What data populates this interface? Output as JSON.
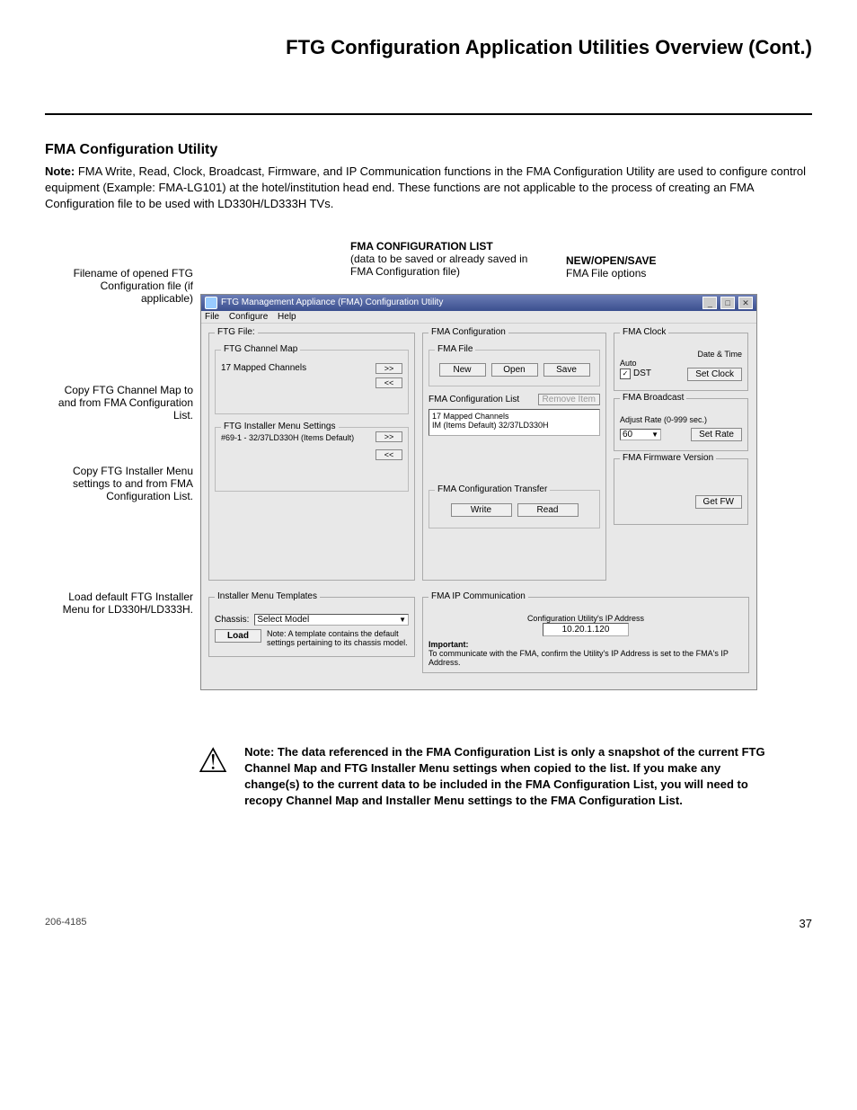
{
  "page": {
    "title": "FTG Configuration Application Utilities Overview (Cont.)",
    "section_title": "FMA Configuration Utility",
    "note_label": "Note:",
    "note_body": " FMA Write, Read, Clock, Broadcast, Firmware, and IP Communication functions in the FMA Configuration Utility are used to configure control equipment (Example: FMA-LG101) at the hotel/institution head end. These functions are not applicable to the process of creating an FMA Configuration file to be used with LD330H/LD333H TVs."
  },
  "callouts": {
    "fma_list_title": "FMA CONFIGURATION LIST",
    "fma_list_body": "(data to be saved or already saved in FMA Configuration file)",
    "new_title": "NEW/OPEN/SAVE",
    "new_body": "FMA File options",
    "side1": "Filename of opened FTG Configuration file (if applicable)",
    "side2": "Copy FTG Channel Map to and from FMA Configuration List.",
    "side3": "Copy FTG Installer Menu settings to and from FMA Configuration List.",
    "side4": "Load default FTG Installer Menu for LD330H/LD333H."
  },
  "window": {
    "title": "FTG Management Appliance (FMA) Configuration Utility",
    "menu": {
      "file": "File",
      "configure": "Configure",
      "help": "Help"
    },
    "ftg_file": {
      "legend": "FTG File:",
      "channel_map": {
        "legend": "FTG Channel Map",
        "count": "17 Mapped Channels",
        "copy_right": ">>",
        "copy_left": "<<"
      },
      "installer": {
        "legend": "FTG Installer Menu Settings",
        "item": "#69-1 - 32/37LD330H (Items Default)",
        "copy_right": ">>",
        "copy_left": "<<"
      }
    },
    "fma_config": {
      "legend": "FMA Configuration",
      "fma_file": {
        "legend": "FMA File",
        "new": "New",
        "open": "Open",
        "save": "Save"
      },
      "list_label": "FMA Configuration List",
      "remove": "Remove Item",
      "list_line1": "17 Mapped Channels",
      "list_line2": "IM (Items Default) 32/37LD330H",
      "transfer": {
        "legend": "FMA Configuration Transfer",
        "write": "Write",
        "read": "Read"
      }
    },
    "clock": {
      "legend": "FMA Clock",
      "date": "Date & Time",
      "auto": "Auto",
      "dst": "DST",
      "set": "Set Clock"
    },
    "broadcast": {
      "legend": "FMA Broadcast",
      "rate_label": "Adjust Rate (0-999 sec.)",
      "rate_value": "60",
      "set_rate": "Set Rate"
    },
    "firmware": {
      "legend": "FMA Firmware Version",
      "get": "Get FW"
    },
    "templates": {
      "legend": "Installer Menu Templates",
      "chassis_label": "Chassis:",
      "chassis_value": "Select Model",
      "load": "Load",
      "note": "Note: A template contains the default settings pertaining to its chassis model."
    },
    "ip": {
      "legend": "FMA IP Communication",
      "addr_label": "Configuration Utility's IP Address",
      "addr_value": "10.20.1.120",
      "important_label": "Important:",
      "important_body": "To communicate with the FMA, confirm the Utility's IP Address is set to the FMA's IP Address."
    },
    "controls": {
      "min": "_",
      "max": "□",
      "close": "✕"
    }
  },
  "warning": {
    "text": "Note: The data referenced in the FMA Configuration List is only a snapshot of the current FTG Channel Map and FTG Installer Menu settings when copied to the list. If you make any change(s) to the current data to be included in the FMA Configuration List, you will need to recopy Channel Map and Installer Menu settings to the FMA Configuration List."
  },
  "footer": {
    "doc": "206-4185",
    "page": "37"
  }
}
